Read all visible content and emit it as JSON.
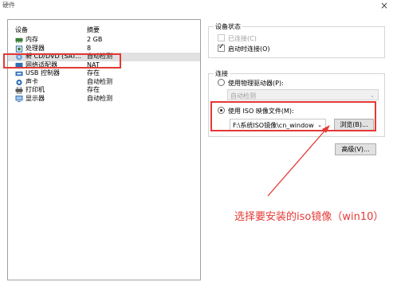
{
  "window": {
    "title": "硬件",
    "close": "×"
  },
  "device_panel": {
    "col_device": "设备",
    "col_summary": "摘要",
    "devices": [
      {
        "name": "内存",
        "summary": "2 GB",
        "icon": "memory-icon",
        "icon_color": "#3a7d3a"
      },
      {
        "name": "处理器",
        "summary": "8",
        "icon": "processor-icon",
        "icon_color": "#2e6db4"
      },
      {
        "name": "新 CD/DVD (SAT...",
        "summary": "自动检测",
        "icon": "cd-dvd-icon",
        "icon_color": "#7aa7d6"
      },
      {
        "name": "网络适配器",
        "summary": "NAT",
        "icon": "network-adapter-icon",
        "icon_color": "#2e6db4"
      },
      {
        "name": "USB 控制器",
        "summary": "存在",
        "icon": "usb-icon",
        "icon_color": "#2e6db4"
      },
      {
        "name": "声卡",
        "summary": "自动检测",
        "icon": "sound-card-icon",
        "icon_color": "#2e6db4"
      },
      {
        "name": "打印机",
        "summary": "存在",
        "icon": "printer-icon",
        "icon_color": "#555555"
      },
      {
        "name": "显示器",
        "summary": "自动检测",
        "icon": "display-icon",
        "icon_color": "#2e6db4"
      }
    ]
  },
  "device_status": {
    "title": "设备状态",
    "connected_label": "已连接(C)",
    "connected_checked": false,
    "connect_on_power_label": "启动时连接(O)",
    "connect_on_power_checked": true
  },
  "connection": {
    "title": "连接",
    "physical_label": "使用物理驱动器(P):",
    "physical_value": "自动检测",
    "iso_label": "使用 ISO 映像文件(M):",
    "iso_value": "F:\\系统ISO镜像\\cn_window",
    "browse_label": "浏览(B)...",
    "selected": "iso"
  },
  "advanced_label": "高级(V)...",
  "annotation": "选择要安装的iso镜像（win10）",
  "colors": {
    "highlight": "#e53935",
    "selected_row": "#e1e1e1"
  }
}
